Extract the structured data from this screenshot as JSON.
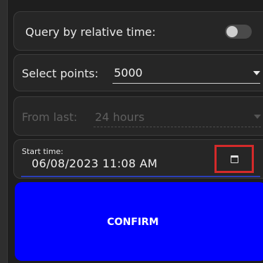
{
  "relative_time": {
    "label": "Query by relative time:",
    "enabled": false
  },
  "select_points": {
    "label": "Select points:",
    "value": "5000"
  },
  "from_last": {
    "label": "From last:",
    "value": "24 hours",
    "disabled": true
  },
  "start_time": {
    "caption": "Start time:",
    "value": "06/08/2023 11:08 AM",
    "picker_icon": "calendar-icon"
  },
  "confirm": {
    "label": "CONFIRM"
  },
  "colors": {
    "confirm_button": "#0000ff",
    "highlight_box": "#d42a2a",
    "focus_underline": "#2b3fb8"
  }
}
